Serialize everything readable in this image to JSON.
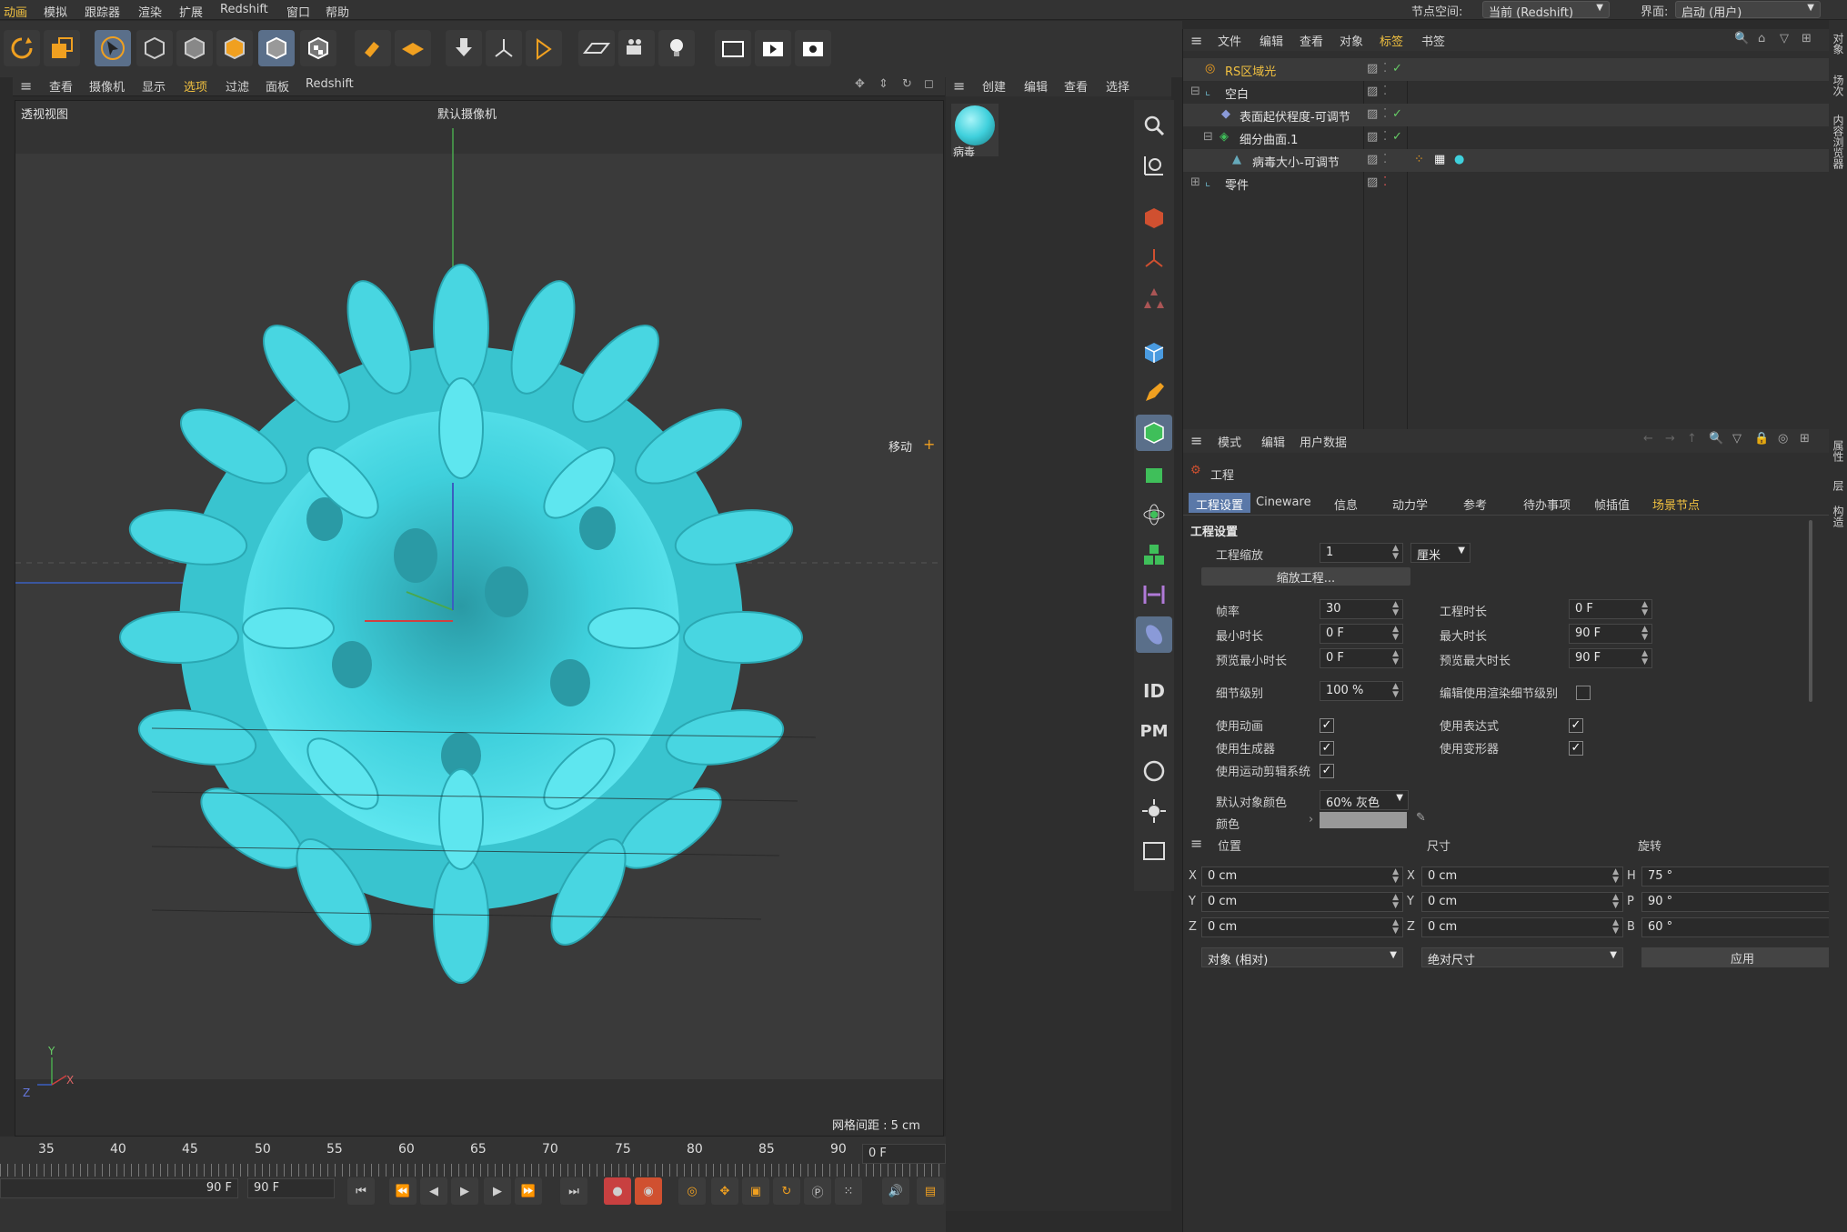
{
  "menu": {
    "items": [
      "动画",
      "模拟",
      "跟踪器",
      "渲染",
      "扩展",
      "Redshift",
      "窗口",
      "帮助"
    ],
    "node_space_label": "节点空间:",
    "node_space_value": "当前 (Redshift)",
    "interface_label": "界面:",
    "interface_value": "启动 (用户)"
  },
  "viewport_menu": [
    "查看",
    "摄像机",
    "显示",
    "选项",
    "过滤",
    "面板",
    "Redshift"
  ],
  "viewport": {
    "view_name": "透视视图",
    "camera": "默认摄像机",
    "move_label": "移动",
    "grid_spacing": "网格间距 : 5 cm",
    "axis_y": "Y",
    "axis_x": "X",
    "axis_z": "Z"
  },
  "timeline": {
    "ticks": [
      "35",
      "40",
      "45",
      "50",
      "55",
      "60",
      "65",
      "70",
      "75",
      "80",
      "85",
      "90"
    ],
    "current_frame": "0 F",
    "end_frame_a": "90 F",
    "end_frame_b": "90 F"
  },
  "material_manager": {
    "menu": [
      "创建",
      "编辑",
      "查看",
      "选择"
    ],
    "material_name": "病毒"
  },
  "object_manager": {
    "menu": [
      "文件",
      "编辑",
      "查看",
      "对象",
      "标签",
      "书签"
    ],
    "objects": [
      {
        "name": "RS区域光"
      },
      {
        "name": "空白"
      },
      {
        "name": "表面起伏程度-可调节"
      },
      {
        "name": "细分曲面.1"
      },
      {
        "name": "病毒大小-可调节"
      },
      {
        "name": "零件"
      }
    ]
  },
  "attribute_manager": {
    "menu": [
      "模式",
      "编辑",
      "用户数据"
    ],
    "header": "工程",
    "tabs": [
      "工程设置",
      "Cineware",
      "信息",
      "动力学",
      "参考",
      "待办事项",
      "帧插值",
      "场景节点"
    ],
    "section_title": "工程设置",
    "project_scale_label": "工程缩放",
    "project_scale_value": "1",
    "project_scale_unit": "厘米",
    "scale_project_button": "缩放工程...",
    "fps_label": "帧率",
    "fps_value": "30",
    "project_time_label": "工程时长",
    "project_time_value": "0 F",
    "min_time_label": "最小时长",
    "min_time_value": "0 F",
    "max_time_label": "最大时长",
    "max_time_value": "90 F",
    "preview_min_label": "预览最小时长",
    "preview_min_value": "0 F",
    "preview_max_label": "预览最大时长",
    "preview_max_value": "90 F",
    "lod_label": "细节级别",
    "lod_value": "100 %",
    "render_lod_label": "编辑使用渲染细节级别",
    "use_animation_label": "使用动画",
    "use_expressions_label": "使用表达式",
    "use_generators_label": "使用生成器",
    "use_deformers_label": "使用变形器",
    "use_motion_system_label": "使用运动剪辑系统",
    "default_color_label": "默认对象颜色",
    "default_color_value": "60% 灰色",
    "color_label": "颜色"
  },
  "coordinates": {
    "col_position": "位置",
    "col_size": "尺寸",
    "col_rotation": "旋转",
    "rows": [
      {
        "pl": "X",
        "pv": "0 cm",
        "sl": "X",
        "sv": "0 cm",
        "rl": "H",
        "rv": "75 °"
      },
      {
        "pl": "Y",
        "pv": "0 cm",
        "sl": "Y",
        "sv": "0 cm",
        "rl": "P",
        "rv": "90 °"
      },
      {
        "pl": "Z",
        "pv": "0 cm",
        "sl": "Z",
        "sv": "0 cm",
        "rl": "B",
        "rv": "60 °"
      }
    ],
    "mode_value": "对象 (相对)",
    "size_mode_value": "绝对尺寸",
    "apply_button": "应用"
  },
  "right_strip": [
    "对象",
    "场次",
    "内容浏览器",
    "属性",
    "层",
    "构造"
  ],
  "colors": {
    "accent": "#5a78a8",
    "virus": "#3fd0dc",
    "highlight_text": "#f0c040"
  }
}
